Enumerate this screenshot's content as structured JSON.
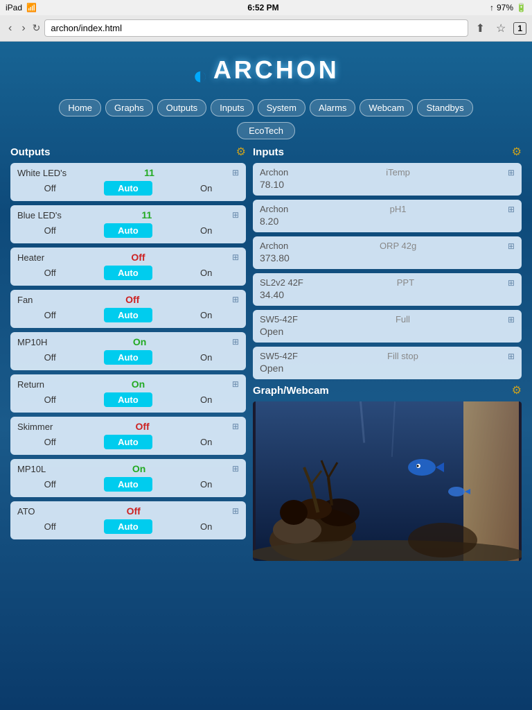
{
  "statusBar": {
    "left": "iPad",
    "wifi": "WiFi",
    "time": "6:52 PM",
    "signal": "↑",
    "battery": "97%",
    "tabs": "1"
  },
  "browser": {
    "url": "archon/index.html",
    "back": "‹",
    "forward": "›",
    "refresh": "↻",
    "share": "⬆",
    "bookmark": "☆"
  },
  "logo": {
    "text": "ARCHON"
  },
  "nav": {
    "items": [
      "Home",
      "Graphs",
      "Outputs",
      "Inputs",
      "System",
      "Alarms",
      "Webcam",
      "Standbys"
    ],
    "sub": [
      "EcoTech"
    ]
  },
  "outputs": {
    "title": "Outputs",
    "items": [
      {
        "name": "White LED's",
        "status": "11",
        "statusClass": "green",
        "buttons": [
          "Off",
          "Auto",
          "On"
        ],
        "activeBtn": "Auto"
      },
      {
        "name": "Blue LED's",
        "status": "11",
        "statusClass": "green",
        "buttons": [
          "Off",
          "Auto",
          "On"
        ],
        "activeBtn": "Auto"
      },
      {
        "name": "Heater",
        "status": "Off",
        "statusClass": "red",
        "buttons": [
          "Off",
          "Auto",
          "On"
        ],
        "activeBtn": "Auto"
      },
      {
        "name": "Fan",
        "status": "Off",
        "statusClass": "red",
        "buttons": [
          "Off",
          "Auto",
          "On"
        ],
        "activeBtn": "Auto"
      },
      {
        "name": "MP10H",
        "status": "On",
        "statusClass": "green",
        "buttons": [
          "Off",
          "Auto",
          "On"
        ],
        "activeBtn": "Auto"
      },
      {
        "name": "Return",
        "status": "On",
        "statusClass": "green",
        "buttons": [
          "Off",
          "Auto",
          "On"
        ],
        "activeBtn": "Auto"
      },
      {
        "name": "Skimmer",
        "status": "Off",
        "statusClass": "red",
        "buttons": [
          "Off",
          "Auto",
          "On"
        ],
        "activeBtn": "Auto"
      },
      {
        "name": "MP10L",
        "status": "On",
        "statusClass": "green",
        "buttons": [
          "Off",
          "Auto",
          "On"
        ],
        "activeBtn": "Auto"
      },
      {
        "name": "ATO",
        "status": "Off",
        "statusClass": "red",
        "buttons": [
          "Off",
          "Auto",
          "On"
        ],
        "activeBtn": "Auto"
      }
    ]
  },
  "inputs": {
    "title": "Inputs",
    "items": [
      {
        "source": "Archon",
        "name": "iTemp",
        "value": "78.10"
      },
      {
        "source": "Archon",
        "name": "pH1",
        "value": "8.20"
      },
      {
        "source": "Archon",
        "name": "ORP 42g",
        "value": "373.80"
      },
      {
        "source": "SL2v2 42F",
        "name": "PPT",
        "value": "34.40"
      },
      {
        "source": "SW5-42F",
        "name": "Full",
        "value": "Open"
      },
      {
        "source": "SW5-42F",
        "name": "Fill stop",
        "value": "Open"
      }
    ]
  },
  "webcam": {
    "title": "Graph/Webcam"
  }
}
